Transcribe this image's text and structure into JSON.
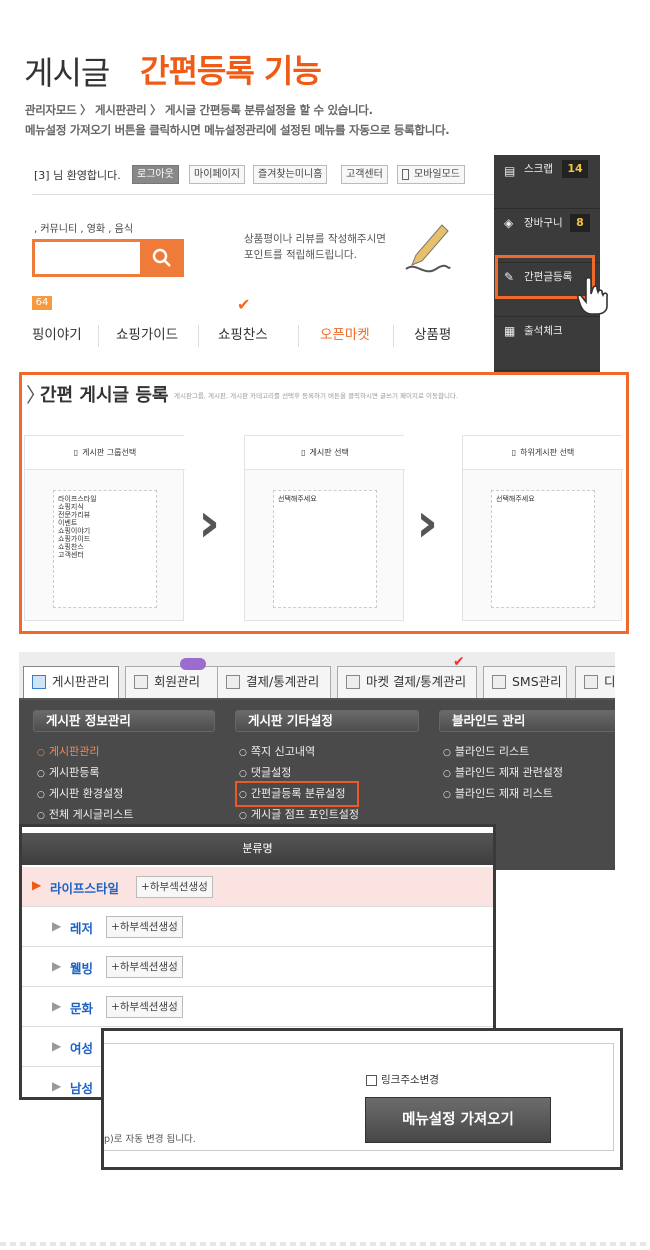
{
  "heading": {
    "prefix": "게시글",
    "highlight": "간편등록 기능"
  },
  "description": [
    "관리자모드 〉 게시판관리 〉 게시글 간편등록 분류설정을 할 수 있습니다.",
    "메뉴설정 가져오기 버튼을 클릭하시면 메뉴설정관리에 설정된 메뉴를 자동으로 등록합니다."
  ],
  "site": {
    "welcome": "[3] 님 환영합니다.",
    "top_buttons": [
      "로그아웃",
      "마이페이지",
      "즐겨찾는미니홈",
      "고객센터",
      "모바일모드"
    ],
    "categories": ", 커뮤니티 , 영화 , 음식",
    "promo_line1": "상품평이나 리뷰를 작성해주시면",
    "promo_line2": "포인트를 적립해드립니다.",
    "badge": "64",
    "nav": [
      "핑이야기",
      "쇼핑가이드",
      "쇼핑찬스",
      "오픈마켓",
      "상품평"
    ],
    "side": [
      {
        "label": "스크랩",
        "count": "14"
      },
      {
        "label": "장바구니",
        "count": "8"
      },
      {
        "label": "간편글등록",
        "count": ""
      },
      {
        "label": "출석체크",
        "count": ""
      }
    ]
  },
  "quick_post": {
    "title": "간편 게시글 등록",
    "subtitle": "게시판그룹, 게시판, 게시판 카테고리를 선택후 등록하기 버튼을 클릭하시면 글쓰기 페이지로 이동합니다.",
    "columns": [
      {
        "header": "게시판 그룹선택",
        "items": [
          "라이프스타일",
          "쇼핑지식",
          "전문가리뷰",
          "이벤트",
          "쇼핑이야기",
          "쇼핑가이드",
          "쇼핑찬스",
          "고객센터"
        ]
      },
      {
        "header": "게시판 선택",
        "items": [
          "선택해주세요"
        ]
      },
      {
        "header": "하위게시판 선택",
        "items": [
          "선택해주세요"
        ]
      }
    ]
  },
  "admin": {
    "tabs": [
      "게시판관리",
      "회원관리",
      "결제/통계관리",
      "마켓 결제/통계관리",
      "SMS관리",
      "디"
    ],
    "groups": [
      {
        "title": "게시판 정보관리",
        "items": [
          "게시판관리",
          "게시판등록",
          "게시판 환경설정",
          "전체 게시글리스트"
        ]
      },
      {
        "title": "게시판 기타설정",
        "items": [
          "쪽지 신고내역",
          "댓글설정",
          "간편글등록 분류설정",
          "게시글 점프 포인트설정"
        ]
      },
      {
        "title": "블라인드 관리",
        "items": [
          "블라인드 리스트",
          "블라인드 제재 관련설정",
          "블라인드 제재 리스트"
        ]
      }
    ],
    "table_header": "분류명",
    "rows": [
      {
        "name": "라이프스타일",
        "button": "하부섹션생성"
      },
      {
        "name": "레저",
        "button": "하부섹션생성"
      },
      {
        "name": "웰빙",
        "button": "하부섹션생성"
      },
      {
        "name": "문화",
        "button": "하부섹션생성"
      },
      {
        "name": "여성",
        "button": ""
      },
      {
        "name": "남성",
        "button": ""
      }
    ],
    "link_change_label": "링크주소변경",
    "import_button": "메뉴설정 가져오기",
    "auto_text": "p)로 자동 변경 됩니다."
  }
}
